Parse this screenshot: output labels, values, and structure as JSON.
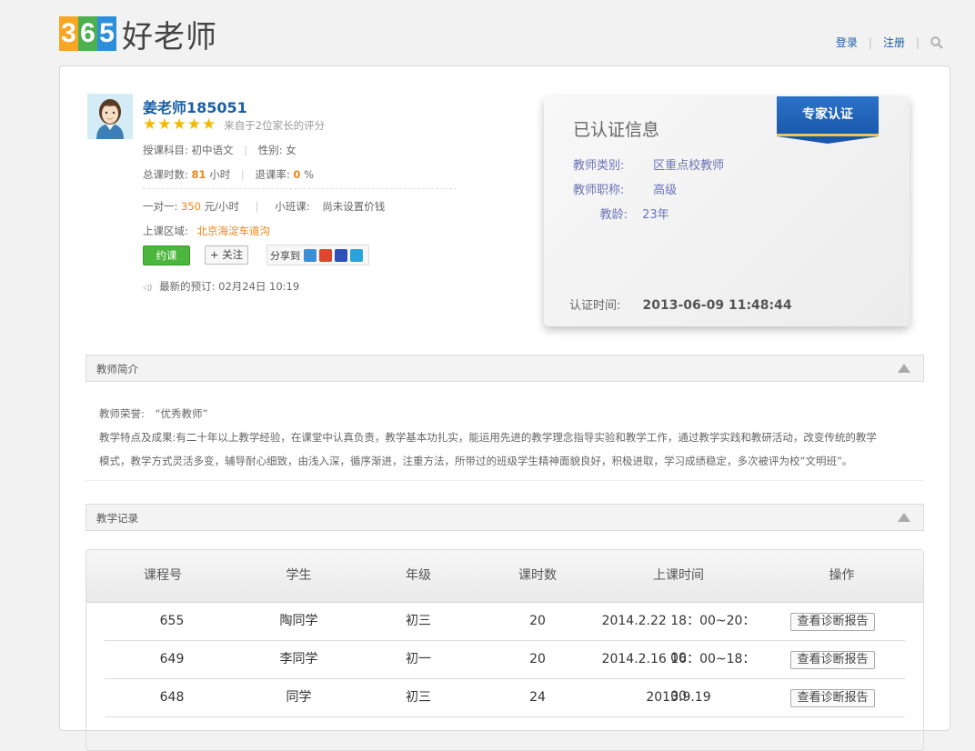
{
  "logo": {
    "digits": [
      "3",
      "6",
      "5"
    ],
    "brand": "好老师"
  },
  "topnav": {
    "login": "登录",
    "sep1": "|",
    "register": "注册",
    "sep2": "|"
  },
  "teacher": {
    "name": "姜老师185051",
    "rating_stars": 5,
    "rating_text": "来自于2位家长的评分",
    "subject_label": "授课科目:",
    "subject": "初中语文",
    "gender_label": "性别:",
    "gender": "女",
    "hours_label": "总课时数:",
    "hours": "81",
    "hours_unit": "小时",
    "refund_label": "退课率:",
    "refund": "0",
    "refund_unit": "%",
    "one_on_one_label": "一对一:",
    "one_on_one_price": "350",
    "one_on_one_unit": "元/小时",
    "small_class_label": "小班课:",
    "small_class_value": "尚未设置价钱",
    "area_label": "上课区域:",
    "area": "北京海淀车道沟",
    "book_button": "约课",
    "follow_button": "+ 关注",
    "share_label": "分享到",
    "latest_label": "最新的预订:",
    "latest_value": "02月24日 10:19"
  },
  "cert": {
    "title": "已认证信息",
    "badge": "专家认证",
    "category_label": "教师类别:",
    "category": "区重点校教师",
    "rank_label": "教师职称:",
    "rank": "高级",
    "years_label": "教龄:",
    "years": "23年",
    "time_label": "认证时间:",
    "time": "2013-06-09 11:48:44"
  },
  "intro": {
    "section_title": "教师简介",
    "honor_label": "教师荣誉:",
    "honor": "“优秀教师”",
    "features_label": "教学特点及成果:",
    "features_line1": "有二十年以上教学经验，在课堂中认真负责，教学基本功扎实，能运用先进的教学理念指导实验和教学工作，通过教学实践和教研活动，改变传统的教学",
    "features_line2": "模式，教学方式灵活多变，辅导耐心细致，由浅入深，循序渐进，注重方法，所带过的班级学生精神面貌良好，积极进取，学习成绩稳定，多次被评为校“文明班”。"
  },
  "records": {
    "section_title": "教学记录",
    "headers": [
      "课程号",
      "学生",
      "年级",
      "课时数",
      "上课时间",
      "操作"
    ],
    "rows": [
      {
        "id": "655",
        "student": "陶同学",
        "grade": "初三",
        "hours": "20",
        "time": "2014.2.22 18：00~20：00",
        "action": "查看诊断报告"
      },
      {
        "id": "649",
        "student": "李同学",
        "grade": "初一",
        "hours": "20",
        "time": "2014.2.16 16：00~18：00",
        "action": "查看诊断报告"
      },
      {
        "id": "648",
        "student": "同学",
        "grade": "初三",
        "hours": "24",
        "time": "2013.9.19",
        "action": "查看诊断报告"
      }
    ]
  },
  "colors": {
    "link": "#1a5fa6",
    "accent": "#f08519",
    "green": "#4bb53d",
    "badge": "#1a56a8"
  }
}
